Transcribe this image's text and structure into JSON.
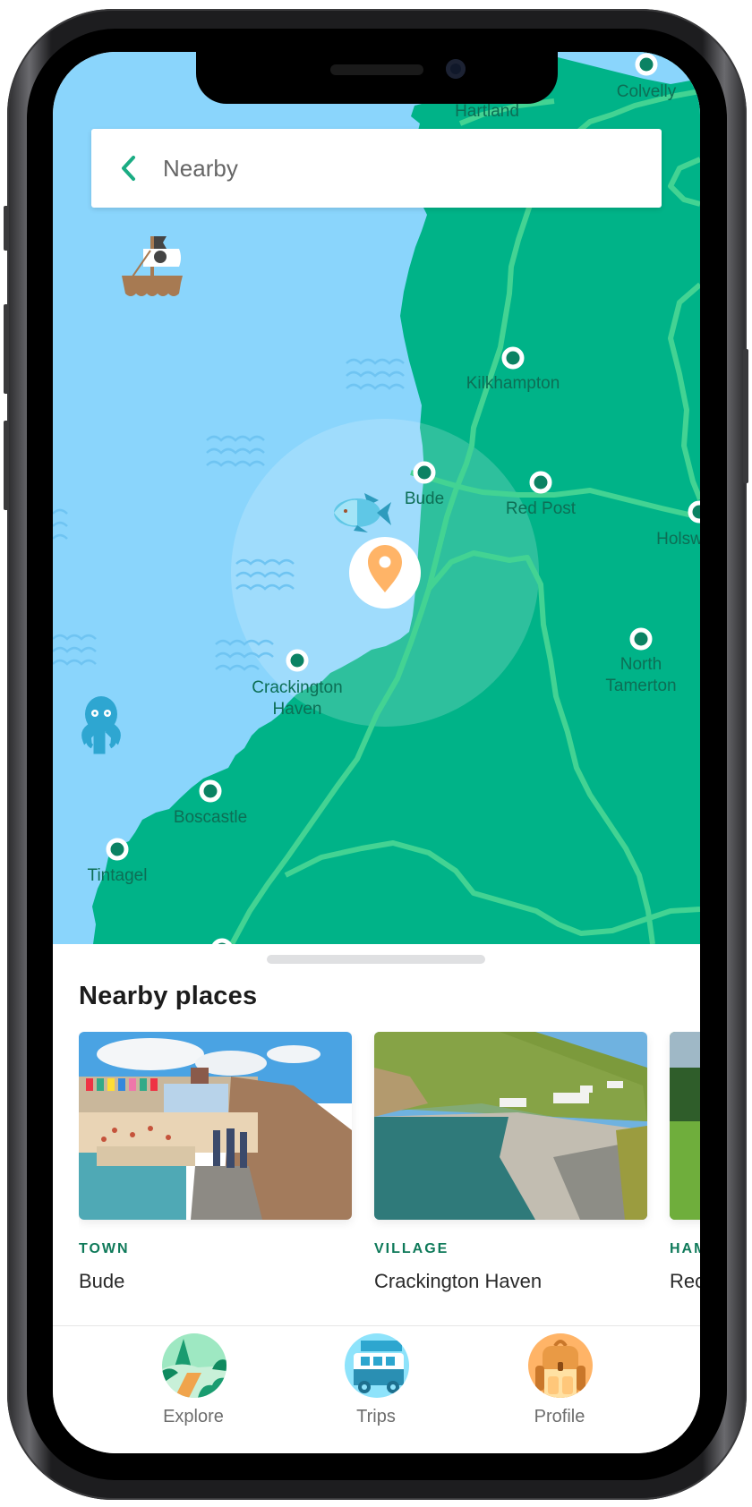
{
  "device": {
    "model": "phone-frame"
  },
  "header": {
    "title": "Nearby",
    "back_icon": "chevron-left-icon"
  },
  "map": {
    "colors": {
      "sea": "#8ad5fc",
      "land": "#00b388",
      "road": "#43d393",
      "marker_fill": "#0b8263",
      "label": "#0d6e55",
      "pin": "#ffb467",
      "radius": "rgba(255,255,255,0.22)"
    },
    "places": [
      {
        "name": "Colvelly",
        "label_lines": [
          "Colvelly"
        ]
      },
      {
        "name": "Hartland",
        "label_lines": [
          "Hartland"
        ]
      },
      {
        "name": "Kilkhampton",
        "label_lines": [
          "Kilkhampton"
        ]
      },
      {
        "name": "Bude",
        "label_lines": [
          "Bude"
        ]
      },
      {
        "name": "Red Post",
        "label_lines": [
          "Red Post"
        ]
      },
      {
        "name": "Holsworthy",
        "label_lines": [
          "Holsw"
        ]
      },
      {
        "name": "North Tamerton",
        "label_lines": [
          "North",
          "Tamerton"
        ]
      },
      {
        "name": "Crackington Haven",
        "label_lines": [
          "Crackington",
          "Haven"
        ]
      },
      {
        "name": "Boscastle",
        "label_lines": [
          "Boscastle"
        ]
      },
      {
        "name": "Tintagel",
        "label_lines": [
          "Tintagel"
        ]
      }
    ],
    "decorations": [
      "pirate-ship",
      "fish",
      "octopus",
      "waves"
    ],
    "current_location_icon": "location-pin-icon"
  },
  "sheet": {
    "title": "Nearby places",
    "places": [
      {
        "type": "TOWN",
        "name": "Bude",
        "photo": "beach-town-photo"
      },
      {
        "type": "VILLAGE",
        "name": "Crackington Haven",
        "photo": "cove-beach-photo"
      },
      {
        "type": "HAMLET",
        "type_visible": "HAM",
        "name": "Red Post",
        "name_visible": "Rec",
        "photo": "green-field-photo"
      }
    ]
  },
  "tabs": [
    {
      "label": "Explore",
      "icon": "landscape-icon"
    },
    {
      "label": "Trips",
      "icon": "campervan-icon"
    },
    {
      "label": "Profile",
      "icon": "backpack-icon"
    }
  ]
}
